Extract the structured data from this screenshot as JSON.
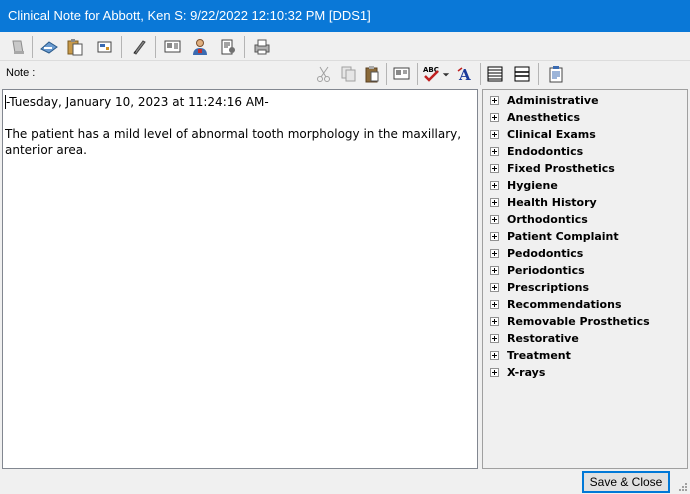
{
  "window": {
    "title": "Clinical Note for Abbott, Ken S: 9/22/2022 12:10:32 PM [DDS1]"
  },
  "toolbar": {
    "note_label": "Note :",
    "icons": [
      "eraser-icon",
      "scanner-icon",
      "paste-note-icon",
      "template-icon",
      "pen-icon",
      "chart-icon",
      "provider-icon",
      "patient-info-icon",
      "print-icon",
      "cut-icon",
      "copy-icon",
      "paste-icon",
      "screen-icon",
      "spellcheck-icon",
      "font-icon",
      "list-view-icon",
      "detail-view-icon",
      "clipboard-icon"
    ]
  },
  "editor": {
    "date_line": "-Tuesday, January 10, 2023 at 11:24:16 AM-",
    "body": "The patient has a mild level of abnormal tooth morphology in the maxillary,\nanterior area."
  },
  "tree": {
    "items": [
      {
        "label": "Administrative"
      },
      {
        "label": "Anesthetics"
      },
      {
        "label": "Clinical Exams"
      },
      {
        "label": "Endodontics"
      },
      {
        "label": "Fixed Prosthetics"
      },
      {
        "label": "Hygiene"
      },
      {
        "label": "Health History"
      },
      {
        "label": "Orthodontics"
      },
      {
        "label": "Patient Complaint"
      },
      {
        "label": "Pedodontics"
      },
      {
        "label": "Periodontics"
      },
      {
        "label": "Prescriptions"
      },
      {
        "label": "Recommendations"
      },
      {
        "label": "Removable Prosthetics"
      },
      {
        "label": "Restorative"
      },
      {
        "label": "Treatment"
      },
      {
        "label": "X-rays"
      }
    ]
  },
  "footer": {
    "save_label": "Save & Close"
  },
  "colors": {
    "title_bar": "#0a78d7",
    "accent": "#0078d7"
  }
}
